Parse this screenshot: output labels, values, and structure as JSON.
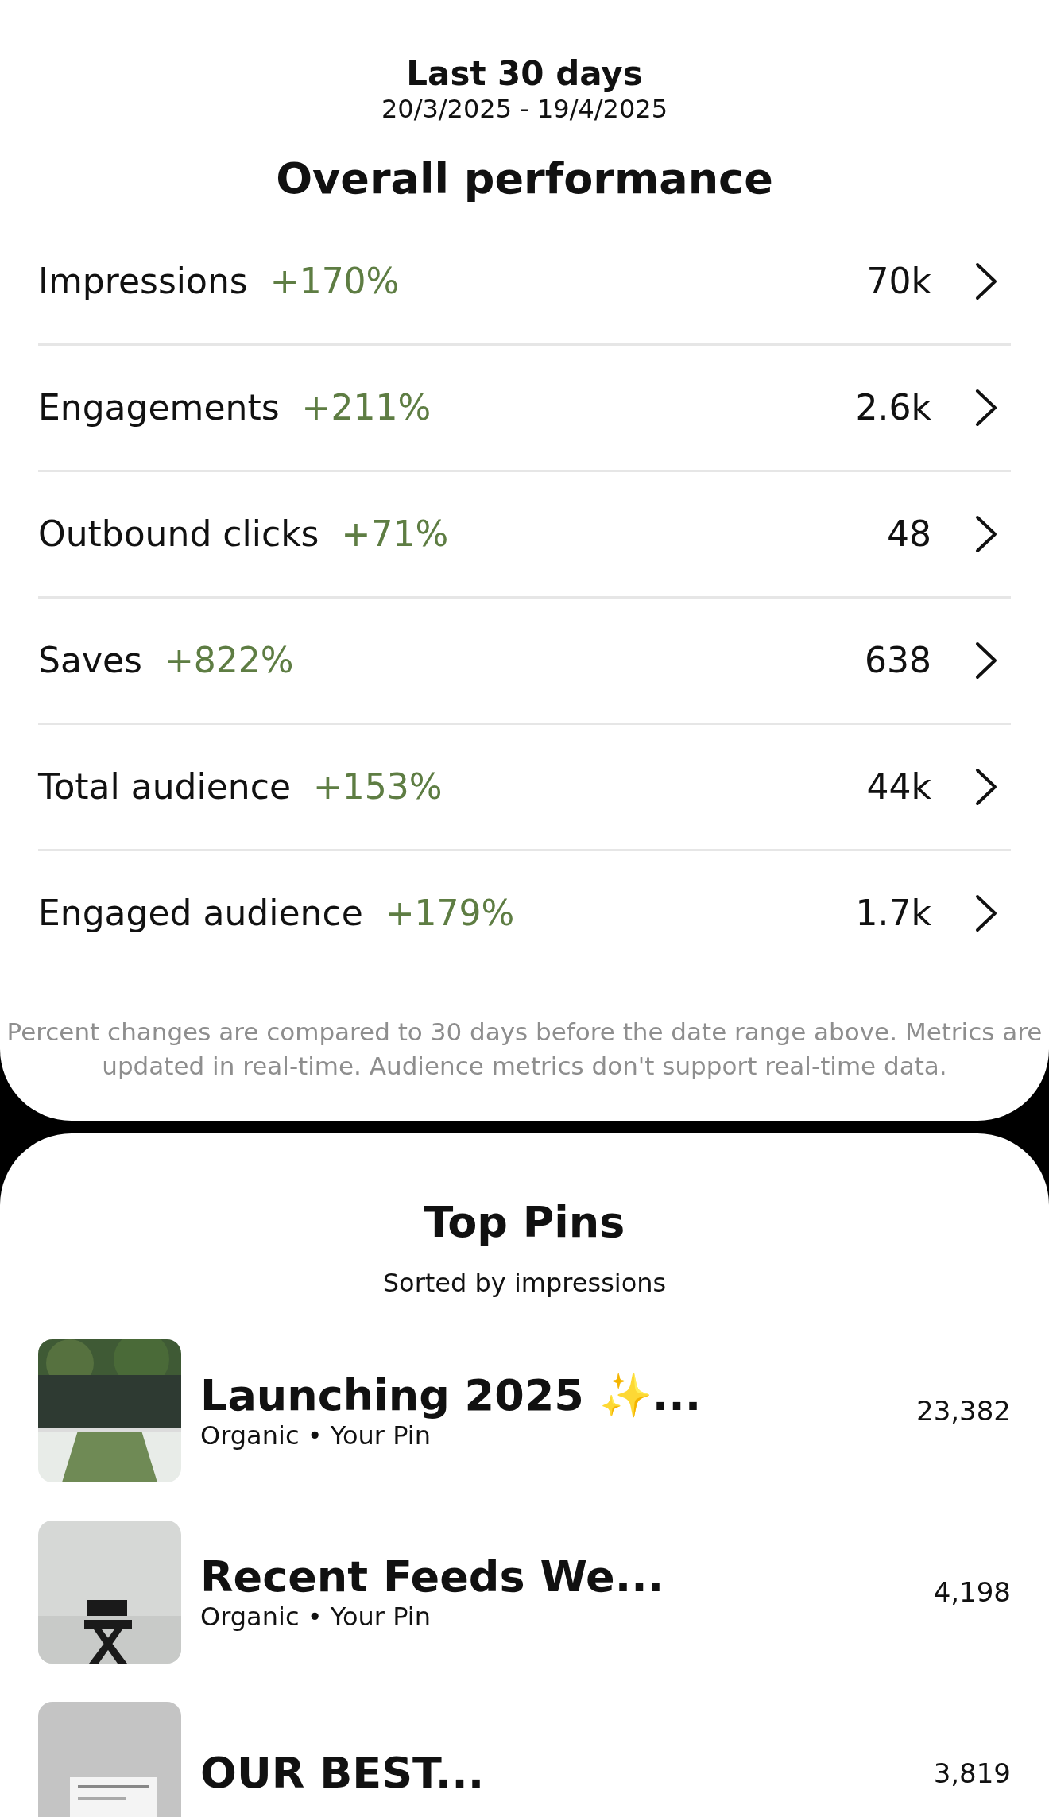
{
  "header": {
    "period": "Last 30 days",
    "date_range": "20/3/2025 - 19/4/2025"
  },
  "overall": {
    "title": "Overall performance",
    "metrics": [
      {
        "label": "Impressions",
        "change": "+170%",
        "value": "70k"
      },
      {
        "label": "Engagements",
        "change": "+211%",
        "value": "2.6k"
      },
      {
        "label": "Outbound clicks",
        "change": "+71%",
        "value": "48"
      },
      {
        "label": "Saves",
        "change": "+822%",
        "value": "638"
      },
      {
        "label": "Total audience",
        "change": "+153%",
        "value": "44k"
      },
      {
        "label": "Engaged audience",
        "change": "+179%",
        "value": "1.7k"
      }
    ],
    "note": "Percent changes are compared to 30 days before the date range above. Metrics are updated in real-time. Audience metrics don't support real-time data."
  },
  "top_pins": {
    "title": "Top Pins",
    "subtitle": "Sorted by impressions",
    "pins": [
      {
        "kind": "picture",
        "title": "Launching 2025 ✨...",
        "subtitle": "Organic • Your Pin",
        "impressions": "23,382"
      },
      {
        "kind": "picture",
        "title": "Recent Feeds We...",
        "subtitle": "Organic • Your Pin",
        "impressions": "4,198"
      },
      {
        "kind": "picture",
        "title": "OUR BEST...",
        "impressions": "3,819"
      }
    ]
  }
}
